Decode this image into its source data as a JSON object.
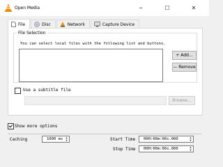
{
  "window": {
    "title": "Open Media",
    "minimize": "–",
    "maximize": "☐",
    "close": "✕"
  },
  "tabs": [
    {
      "label": "File",
      "icon": "file-icon"
    },
    {
      "label": "Disc",
      "icon": "disc-icon"
    },
    {
      "label": "Network",
      "icon": "network-icon"
    },
    {
      "label": "Capture Device",
      "icon": "capture-device-icon"
    }
  ],
  "file_selection": {
    "legend": "File Selection",
    "hint": "You can select local files with the following list and buttons.",
    "add_label": "+ Add...",
    "remove_label": "— Remove"
  },
  "subtitle": {
    "checkbox_label": "Use a subtitle file",
    "checked": false,
    "browse_label": "Browse..."
  },
  "options": {
    "show_more_label": "Show more options",
    "show_more_checked": true,
    "caching_label": "Caching",
    "caching_value": "1000 ms",
    "start_time_label": "Start Time",
    "start_time_value": "00H:00m:00s.000",
    "stop_time_label": "Stop Time",
    "stop_time_value": "00H:00m:00s.000"
  },
  "colors": {
    "vlc_orange": "#f08a00",
    "window_bg": "#f0f0f0",
    "border": "#d9d9d9"
  }
}
